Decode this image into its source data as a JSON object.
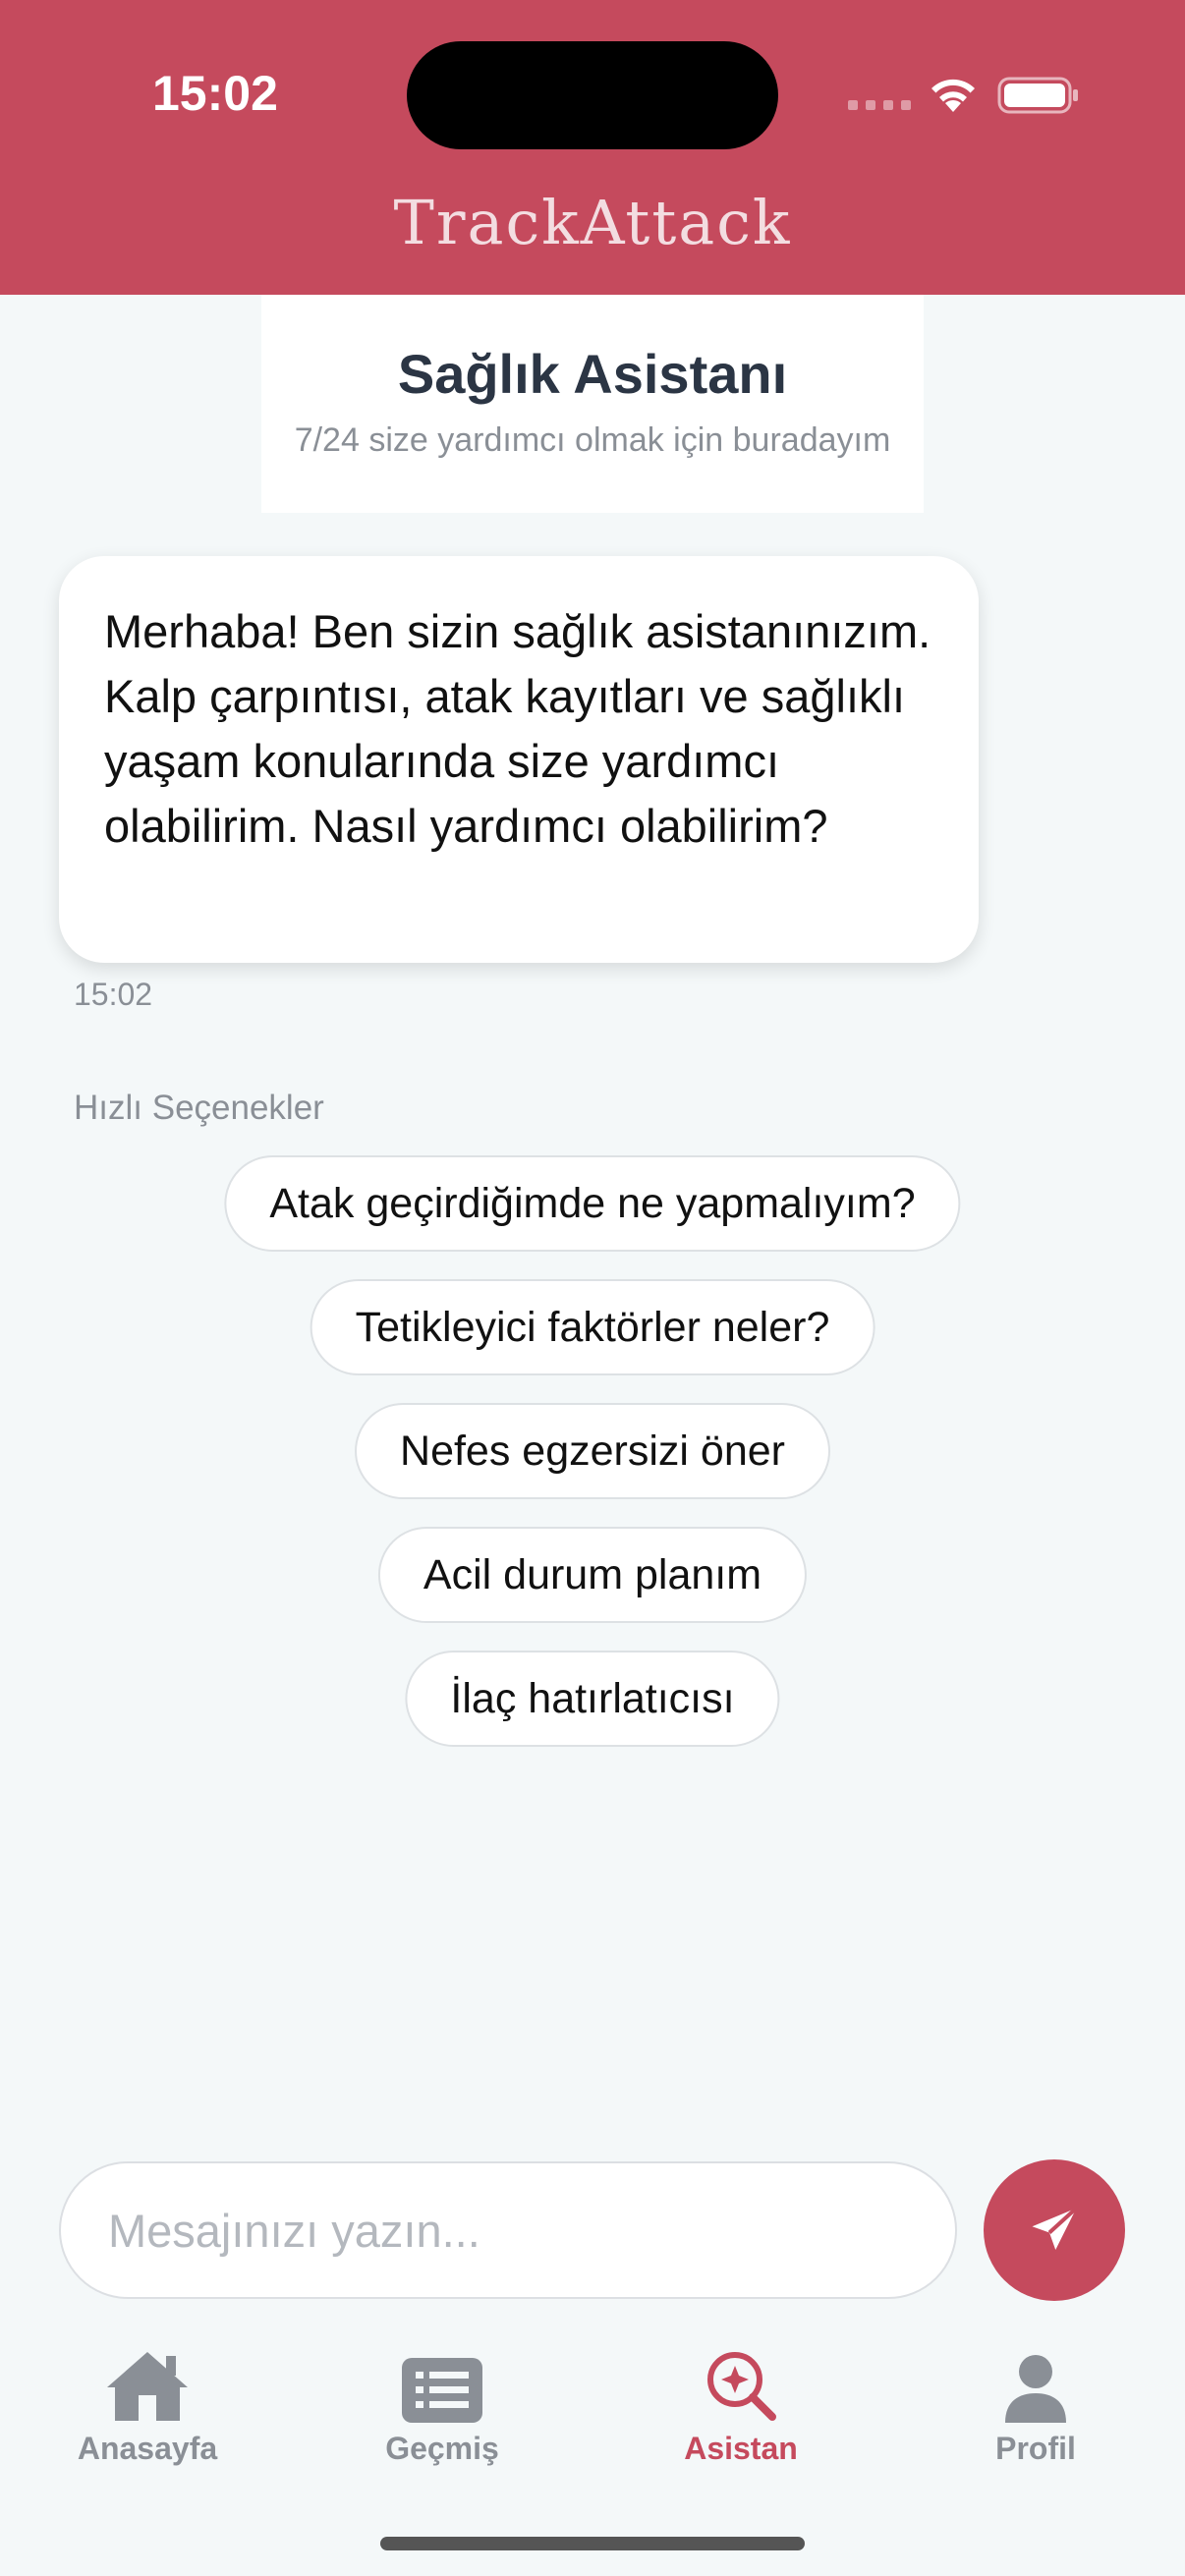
{
  "status_bar": {
    "time": "15:02"
  },
  "app": {
    "title": "TrackAttack",
    "accent_color": "#c54a5d"
  },
  "assistant": {
    "title": "Sağlık Asistanı",
    "subtitle": "7/24 size yardımcı olmak için buradayım"
  },
  "messages": [
    {
      "sender": "assistant",
      "text": "Merhaba! Ben sizin sağlık asistanınızım. Kalp çarpıntısı, atak kayıtları ve sağlıklı yaşam konularında size yardımcı olabilirim. Nasıl yardımcı olabilirim?",
      "time": "15:02"
    }
  ],
  "quick_options": {
    "label": "Hızlı Seçenekler",
    "items": [
      "Atak geçirdiğimde ne yapmalıyım?",
      "Tetikleyici faktörler neler?",
      "Nefes egzersizi öner",
      "Acil durum planım",
      "İlaç hatırlatıcısı"
    ]
  },
  "input": {
    "placeholder": "Mesajınızı yazın...",
    "value": ""
  },
  "nav": {
    "items": [
      {
        "label": "Anasayfa",
        "icon": "home-icon",
        "active": false
      },
      {
        "label": "Geçmiş",
        "icon": "list-icon",
        "active": false
      },
      {
        "label": "Asistan",
        "icon": "search-sparkle-icon",
        "active": true
      },
      {
        "label": "Profil",
        "icon": "person-icon",
        "active": false
      }
    ]
  }
}
